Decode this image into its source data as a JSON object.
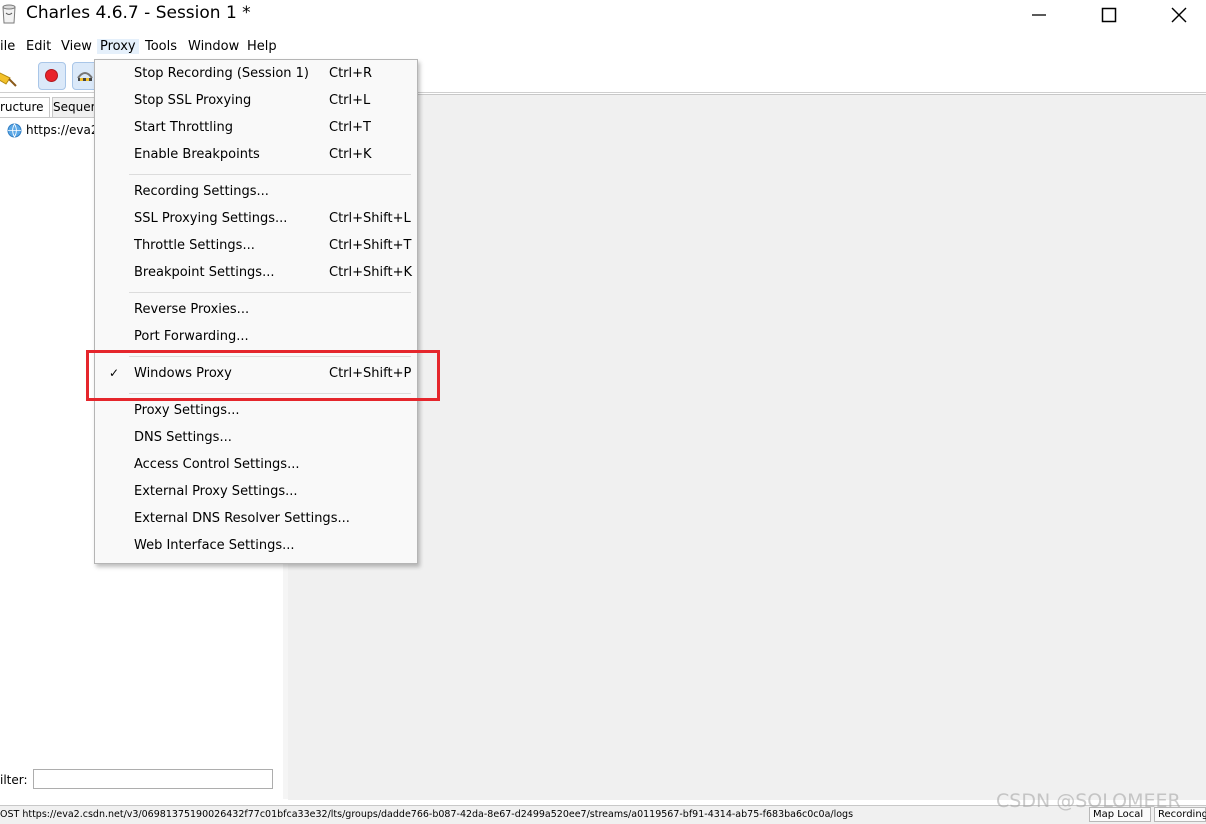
{
  "window": {
    "title": "Charles 4.6.7 - Session 1 *"
  },
  "menubar": {
    "items": [
      "ile",
      "Edit",
      "View",
      "Proxy",
      "Tools",
      "Window",
      "Help"
    ]
  },
  "left_panel": {
    "tabs": [
      "ructure",
      "Sequer"
    ],
    "tree_item": "https://eva2",
    "filter_label": "ilter:",
    "filter_value": ""
  },
  "proxy_menu": {
    "items": [
      {
        "label": "Stop Recording (Session 1)",
        "shortcut": "Ctrl+R"
      },
      {
        "label": "Stop SSL Proxying",
        "shortcut": "Ctrl+L"
      },
      {
        "label": "Start Throttling",
        "shortcut": "Ctrl+T"
      },
      {
        "label": "Enable Breakpoints",
        "shortcut": "Ctrl+K"
      },
      {
        "label": "Recording Settings...",
        "shortcut": ""
      },
      {
        "label": "SSL Proxying Settings...",
        "shortcut": "Ctrl+Shift+L"
      },
      {
        "label": "Throttle Settings...",
        "shortcut": "Ctrl+Shift+T"
      },
      {
        "label": "Breakpoint Settings...",
        "shortcut": "Ctrl+Shift+K"
      },
      {
        "label": "Reverse Proxies...",
        "shortcut": ""
      },
      {
        "label": "Port Forwarding...",
        "shortcut": ""
      },
      {
        "label": "Windows Proxy",
        "shortcut": "Ctrl+Shift+P",
        "checked": true
      },
      {
        "label": "Proxy Settings...",
        "shortcut": ""
      },
      {
        "label": "DNS Settings...",
        "shortcut": ""
      },
      {
        "label": "Access Control Settings...",
        "shortcut": ""
      },
      {
        "label": "External Proxy Settings...",
        "shortcut": ""
      },
      {
        "label": "External DNS Resolver Settings...",
        "shortcut": ""
      },
      {
        "label": "Web Interface Settings...",
        "shortcut": ""
      }
    ],
    "check_mark": "✓"
  },
  "statusbar": {
    "text": "OST https://eva2.csdn.net/v3/06981375190026432f77c01bfca33e32/lts/groups/dadde766-b087-42da-8e67-d2499a520ee7/streams/a0119567-bf91-4314-ab75-f683ba6c0c0a/logs",
    "map_local": "Map Local",
    "recording": "Recording"
  },
  "watermark": "CSDN @SOLOMEER",
  "colors": {
    "highlight": "#e5262c",
    "record": "#e8222a"
  }
}
